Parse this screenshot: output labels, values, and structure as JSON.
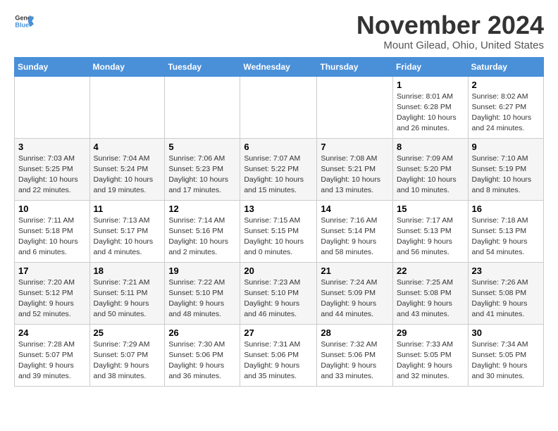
{
  "logo": {
    "text_general": "General",
    "text_blue": "Blue"
  },
  "title": "November 2024",
  "subtitle": "Mount Gilead, Ohio, United States",
  "weekdays": [
    "Sunday",
    "Monday",
    "Tuesday",
    "Wednesday",
    "Thursday",
    "Friday",
    "Saturday"
  ],
  "weeks": [
    [
      {
        "day": "",
        "info": ""
      },
      {
        "day": "",
        "info": ""
      },
      {
        "day": "",
        "info": ""
      },
      {
        "day": "",
        "info": ""
      },
      {
        "day": "",
        "info": ""
      },
      {
        "day": "1",
        "info": "Sunrise: 8:01 AM\nSunset: 6:28 PM\nDaylight: 10 hours and 26 minutes."
      },
      {
        "day": "2",
        "info": "Sunrise: 8:02 AM\nSunset: 6:27 PM\nDaylight: 10 hours and 24 minutes."
      }
    ],
    [
      {
        "day": "3",
        "info": "Sunrise: 7:03 AM\nSunset: 5:25 PM\nDaylight: 10 hours and 22 minutes."
      },
      {
        "day": "4",
        "info": "Sunrise: 7:04 AM\nSunset: 5:24 PM\nDaylight: 10 hours and 19 minutes."
      },
      {
        "day": "5",
        "info": "Sunrise: 7:06 AM\nSunset: 5:23 PM\nDaylight: 10 hours and 17 minutes."
      },
      {
        "day": "6",
        "info": "Sunrise: 7:07 AM\nSunset: 5:22 PM\nDaylight: 10 hours and 15 minutes."
      },
      {
        "day": "7",
        "info": "Sunrise: 7:08 AM\nSunset: 5:21 PM\nDaylight: 10 hours and 13 minutes."
      },
      {
        "day": "8",
        "info": "Sunrise: 7:09 AM\nSunset: 5:20 PM\nDaylight: 10 hours and 10 minutes."
      },
      {
        "day": "9",
        "info": "Sunrise: 7:10 AM\nSunset: 5:19 PM\nDaylight: 10 hours and 8 minutes."
      }
    ],
    [
      {
        "day": "10",
        "info": "Sunrise: 7:11 AM\nSunset: 5:18 PM\nDaylight: 10 hours and 6 minutes."
      },
      {
        "day": "11",
        "info": "Sunrise: 7:13 AM\nSunset: 5:17 PM\nDaylight: 10 hours and 4 minutes."
      },
      {
        "day": "12",
        "info": "Sunrise: 7:14 AM\nSunset: 5:16 PM\nDaylight: 10 hours and 2 minutes."
      },
      {
        "day": "13",
        "info": "Sunrise: 7:15 AM\nSunset: 5:15 PM\nDaylight: 10 hours and 0 minutes."
      },
      {
        "day": "14",
        "info": "Sunrise: 7:16 AM\nSunset: 5:14 PM\nDaylight: 9 hours and 58 minutes."
      },
      {
        "day": "15",
        "info": "Sunrise: 7:17 AM\nSunset: 5:13 PM\nDaylight: 9 hours and 56 minutes."
      },
      {
        "day": "16",
        "info": "Sunrise: 7:18 AM\nSunset: 5:13 PM\nDaylight: 9 hours and 54 minutes."
      }
    ],
    [
      {
        "day": "17",
        "info": "Sunrise: 7:20 AM\nSunset: 5:12 PM\nDaylight: 9 hours and 52 minutes."
      },
      {
        "day": "18",
        "info": "Sunrise: 7:21 AM\nSunset: 5:11 PM\nDaylight: 9 hours and 50 minutes."
      },
      {
        "day": "19",
        "info": "Sunrise: 7:22 AM\nSunset: 5:10 PM\nDaylight: 9 hours and 48 minutes."
      },
      {
        "day": "20",
        "info": "Sunrise: 7:23 AM\nSunset: 5:10 PM\nDaylight: 9 hours and 46 minutes."
      },
      {
        "day": "21",
        "info": "Sunrise: 7:24 AM\nSunset: 5:09 PM\nDaylight: 9 hours and 44 minutes."
      },
      {
        "day": "22",
        "info": "Sunrise: 7:25 AM\nSunset: 5:08 PM\nDaylight: 9 hours and 43 minutes."
      },
      {
        "day": "23",
        "info": "Sunrise: 7:26 AM\nSunset: 5:08 PM\nDaylight: 9 hours and 41 minutes."
      }
    ],
    [
      {
        "day": "24",
        "info": "Sunrise: 7:28 AM\nSunset: 5:07 PM\nDaylight: 9 hours and 39 minutes."
      },
      {
        "day": "25",
        "info": "Sunrise: 7:29 AM\nSunset: 5:07 PM\nDaylight: 9 hours and 38 minutes."
      },
      {
        "day": "26",
        "info": "Sunrise: 7:30 AM\nSunset: 5:06 PM\nDaylight: 9 hours and 36 minutes."
      },
      {
        "day": "27",
        "info": "Sunrise: 7:31 AM\nSunset: 5:06 PM\nDaylight: 9 hours and 35 minutes."
      },
      {
        "day": "28",
        "info": "Sunrise: 7:32 AM\nSunset: 5:06 PM\nDaylight: 9 hours and 33 minutes."
      },
      {
        "day": "29",
        "info": "Sunrise: 7:33 AM\nSunset: 5:05 PM\nDaylight: 9 hours and 32 minutes."
      },
      {
        "day": "30",
        "info": "Sunrise: 7:34 AM\nSunset: 5:05 PM\nDaylight: 9 hours and 30 minutes."
      }
    ]
  ]
}
